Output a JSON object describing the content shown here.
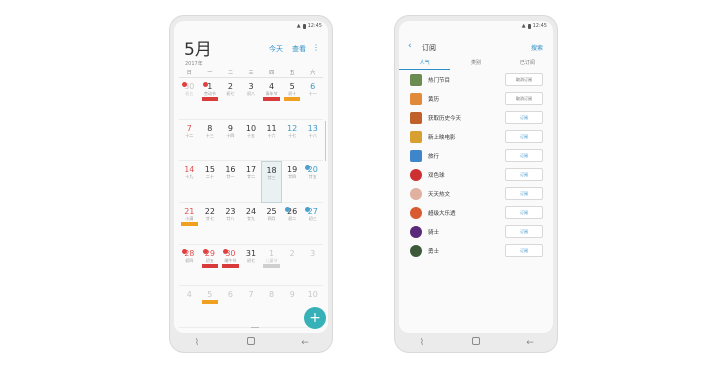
{
  "status": {
    "time": "12:45"
  },
  "calendar": {
    "month": "5月",
    "year": "2017年",
    "today_btn": "今天",
    "view_btn": "查看",
    "weekdays": [
      "日",
      "一",
      "二",
      "三",
      "四",
      "五",
      "六"
    ],
    "weeks": [
      [
        {
          "d": "30",
          "s": "初五",
          "t": "other"
        },
        {
          "d": "1",
          "s": "劳动节"
        },
        {
          "d": "2",
          "s": "初七"
        },
        {
          "d": "3",
          "s": "初八"
        },
        {
          "d": "4",
          "s": "青年节"
        },
        {
          "d": "5",
          "s": "初十"
        },
        {
          "d": "6",
          "s": "十一",
          "t": "sat"
        }
      ],
      [
        {
          "d": "7",
          "s": "十二",
          "t": "sun"
        },
        {
          "d": "8",
          "s": "十三"
        },
        {
          "d": "9",
          "s": "十四"
        },
        {
          "d": "10",
          "s": "十五"
        },
        {
          "d": "11",
          "s": "十六"
        },
        {
          "d": "12",
          "s": "十七",
          "t": "sat"
        },
        {
          "d": "13",
          "s": "十八",
          "t": "sat"
        }
      ],
      [
        {
          "d": "14",
          "s": "十九",
          "t": "sun"
        },
        {
          "d": "15",
          "s": "二十"
        },
        {
          "d": "16",
          "s": "廿一"
        },
        {
          "d": "17",
          "s": "廿二"
        },
        {
          "d": "18",
          "s": "廿三",
          "t": "today"
        },
        {
          "d": "19",
          "s": "廿四"
        },
        {
          "d": "20",
          "s": "廿五",
          "t": "sat"
        }
      ],
      [
        {
          "d": "21",
          "s": "小满",
          "t": "sun"
        },
        {
          "d": "22",
          "s": "廿七"
        },
        {
          "d": "23",
          "s": "廿八"
        },
        {
          "d": "24",
          "s": "廿九"
        },
        {
          "d": "25",
          "s": "四月"
        },
        {
          "d": "26",
          "s": "初二"
        },
        {
          "d": "27",
          "s": "初三",
          "t": "sat"
        }
      ],
      [
        {
          "d": "28",
          "s": "初四",
          "t": "sun"
        },
        {
          "d": "29",
          "s": "初五",
          "t": "sun"
        },
        {
          "d": "30",
          "s": "端午节",
          "t": "sun"
        },
        {
          "d": "31",
          "s": "初七"
        },
        {
          "d": "1",
          "s": "儿童节",
          "t": "other"
        },
        {
          "d": "2",
          "s": "",
          "t": "other"
        },
        {
          "d": "3",
          "s": "",
          "t": "other"
        }
      ],
      [
        {
          "d": "4",
          "s": "",
          "t": "other"
        },
        {
          "d": "5",
          "s": "",
          "t": "other"
        },
        {
          "d": "6",
          "s": "",
          "t": "other"
        },
        {
          "d": "7",
          "s": "",
          "t": "other"
        },
        {
          "d": "8",
          "s": "",
          "t": "other"
        },
        {
          "d": "9",
          "s": "",
          "t": "other"
        },
        {
          "d": "10",
          "s": "",
          "t": "other"
        }
      ]
    ],
    "fab_label": "+"
  },
  "subscribe": {
    "title": "订阅",
    "search": "搜索",
    "tabs": [
      "人气",
      "类别",
      "已订阅"
    ],
    "items": [
      {
        "name": "热门节目",
        "button": "取消订阅",
        "on": false,
        "color": "#6b8c4f"
      },
      {
        "name": "黄历",
        "button": "取消订阅",
        "on": false,
        "color": "#e08a3a"
      },
      {
        "name": "获取历史今天",
        "button": "订阅",
        "on": true,
        "color": "#c0602a"
      },
      {
        "name": "新上映电影",
        "button": "订阅",
        "on": true,
        "color": "#d8a030"
      },
      {
        "name": "旅行",
        "button": "订阅",
        "on": true,
        "color": "#3f85c9"
      },
      {
        "name": "双色球",
        "button": "订阅",
        "on": true,
        "color": "#cc3030"
      },
      {
        "name": "天天热文",
        "button": "订阅",
        "on": true,
        "color": "#e0b0a0"
      },
      {
        "name": "超级大乐透",
        "button": "订阅",
        "on": true,
        "color": "#d85a30"
      },
      {
        "name": "骑士",
        "button": "订阅",
        "on": true,
        "color": "#5b2a7a"
      },
      {
        "name": "勇士",
        "button": "订阅",
        "on": true,
        "color": "#3c5a3a"
      }
    ]
  }
}
